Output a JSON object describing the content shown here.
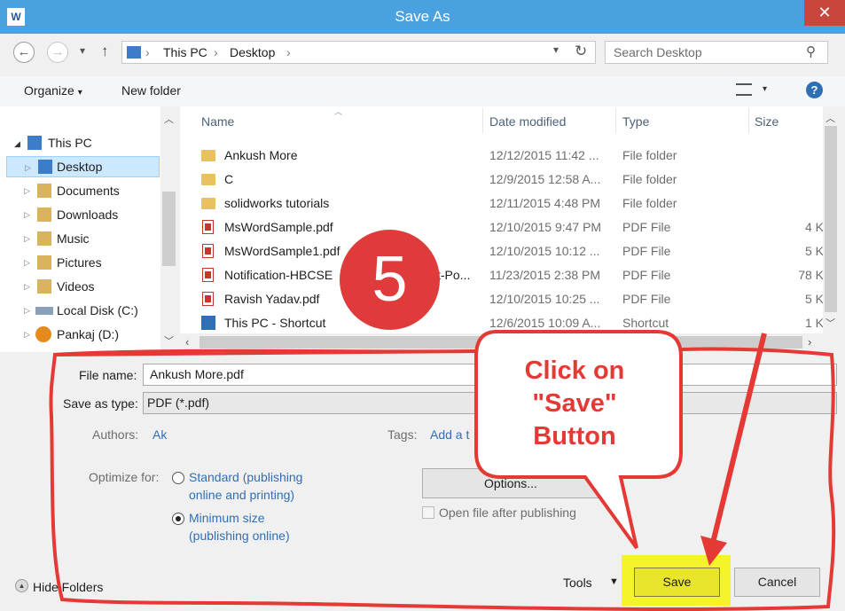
{
  "window": {
    "title": "Save As",
    "app_icon_letter": "W",
    "close_glyph": "✕"
  },
  "nav": {
    "back_glyph": "←",
    "forward_glyph": "→",
    "dropdown_glyph": "▾",
    "up_glyph": "↑",
    "breadcrumbs": [
      "This PC",
      "Desktop"
    ],
    "separator_glyph": "›",
    "refresh_glyph": "↻",
    "search_placeholder": "Search Desktop",
    "search_glyph": "⚲"
  },
  "toolbar": {
    "organize_label": "Organize",
    "new_folder_label": "New folder",
    "help_glyph": "?"
  },
  "tree": [
    {
      "label": "This PC",
      "icon": "computer-icon"
    },
    {
      "label": "Desktop",
      "icon": "desktop-icon",
      "selected": true
    },
    {
      "label": "Documents",
      "icon": "documents-icon"
    },
    {
      "label": "Downloads",
      "icon": "downloads-icon"
    },
    {
      "label": "Music",
      "icon": "music-icon"
    },
    {
      "label": "Pictures",
      "icon": "pictures-icon"
    },
    {
      "label": "Videos",
      "icon": "videos-icon"
    },
    {
      "label": "Local Disk (C:)",
      "icon": "drive-icon"
    },
    {
      "label": "Pankaj (D:)",
      "icon": "user-drive-icon"
    }
  ],
  "columns": {
    "name": "Name",
    "date": "Date modified",
    "type": "Type",
    "size": "Size"
  },
  "files": [
    {
      "name": "Ankush More",
      "date": "12/12/2015 11:42 ...",
      "type": "File folder",
      "size": "",
      "kind": "folder"
    },
    {
      "name": "C",
      "date": "12/9/2015 12:58 A...",
      "type": "File folder",
      "size": "",
      "kind": "folder"
    },
    {
      "name": "solidworks tutorials",
      "date": "12/11/2015 4:48 PM",
      "type": "File folder",
      "size": "",
      "kind": "folder"
    },
    {
      "name": "MsWordSample.pdf",
      "date": "12/10/2015 9:47 PM",
      "type": "PDF File",
      "size": "4 K",
      "kind": "pdf"
    },
    {
      "name": "MsWordSample1.pdf",
      "date": "12/10/2015 10:12 ...",
      "type": "PDF File",
      "size": "5 K",
      "kind": "pdf"
    },
    {
      "name": "Notification-HBCSE",
      "name_tail": "t-Po...",
      "date": "11/23/2015 2:38 PM",
      "type": "PDF File",
      "size": "78 K",
      "kind": "pdf"
    },
    {
      "name": "Ravish Yadav.pdf",
      "date": "12/10/2015 10:25 ...",
      "type": "PDF File",
      "size": "5 K",
      "kind": "pdf"
    },
    {
      "name": "This PC - Shortcut",
      "date": "12/6/2015 10:09 A...",
      "type": "Shortcut",
      "size": "1 K",
      "kind": "shortcut"
    }
  ],
  "form": {
    "file_name_label": "File name:",
    "file_name_value": "Ankush More.pdf",
    "save_type_label": "Save as type:",
    "save_type_value": "PDF (*.pdf)",
    "authors_label": "Authors:",
    "authors_value": "Ak",
    "tags_label": "Tags:",
    "tags_value": "Add a t",
    "optimize_label": "Optimize for:",
    "standard_label_1": "Standard (publishing",
    "standard_label_2": "online and printing)",
    "minimum_label_1": "Minimum size",
    "minimum_label_2": "(publishing online)",
    "optimize_selected": "Minimum size",
    "options_label": "Options...",
    "open_after_label": "Open file after publishing",
    "open_after_checked": false
  },
  "footer": {
    "hide_folders_label": "Hide Folders",
    "tools_label": "Tools",
    "save_label": "Save",
    "cancel_label": "Cancel"
  },
  "annotations": {
    "step_number": "5",
    "callout_line1": "Click on",
    "callout_line2": "\"Save\"",
    "callout_line3": "Button",
    "annotation_color": "#e53935",
    "highlight_color": "#f5f32a"
  }
}
